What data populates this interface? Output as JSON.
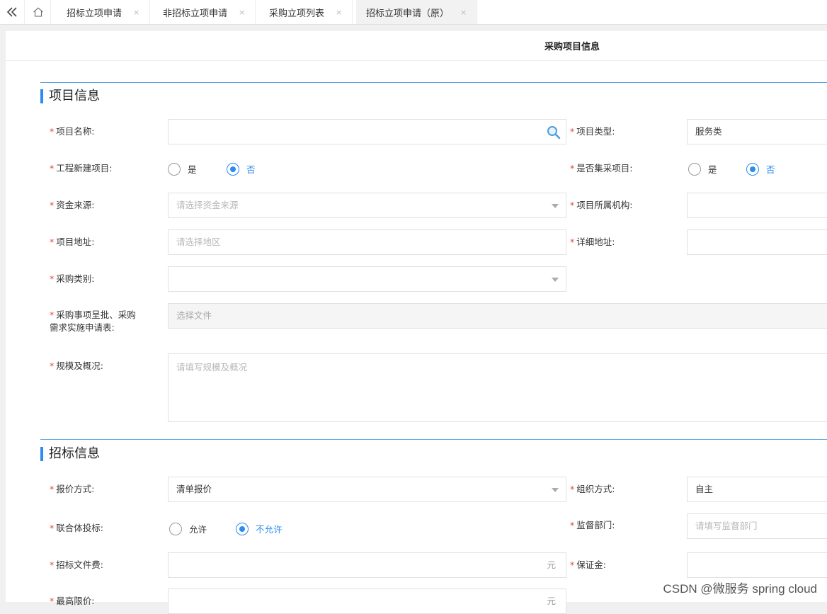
{
  "tabs": [
    {
      "label": "招标立项申请",
      "close": "×"
    },
    {
      "label": "非招标立项申请",
      "close": "×"
    },
    {
      "label": "采购立项列表",
      "close": "×"
    },
    {
      "label": "招标立项申请（原）",
      "close": "×"
    }
  ],
  "page_title": "采购项目信息",
  "sections": {
    "project": "项目信息",
    "bidding": "招标信息"
  },
  "form": {
    "project_name": {
      "label": "项目名称:",
      "value": ""
    },
    "project_type": {
      "label": "项目类型:",
      "value": "服务类"
    },
    "new_engineering": {
      "label": "工程新建项目:",
      "options": [
        "是",
        "否"
      ],
      "selected": "否"
    },
    "centralized": {
      "label": "是否集采项目:",
      "options": [
        "是",
        "否"
      ],
      "selected": "否"
    },
    "fund_source": {
      "label": "资金来源:",
      "placeholder": "请选择资金来源"
    },
    "org": {
      "label": "项目所属机构:",
      "value": ""
    },
    "address": {
      "label": "项目地址:",
      "placeholder": "请选择地区"
    },
    "detail_address": {
      "label": "详细地址:",
      "value": ""
    },
    "purchase_category": {
      "label": "采购类别:",
      "value": ""
    },
    "approval_file": {
      "label_line1": "采购事项呈批、采购",
      "label_line2": "需求实施申请表:",
      "placeholder": "选择文件"
    },
    "scale": {
      "label": "规模及概况:",
      "placeholder": "请填写规模及概况"
    },
    "quote_method": {
      "label": "报价方式:",
      "value": "清单报价"
    },
    "org_method": {
      "label": "组织方式:",
      "value": "自主"
    },
    "consortium": {
      "label": "联合体投标:",
      "options": [
        "允许",
        "不允许"
      ],
      "selected": "不允许"
    },
    "supervisor": {
      "label": "监督部门:",
      "placeholder": "请填写监督部门"
    },
    "doc_fee": {
      "label": "招标文件费:",
      "unit": "元"
    },
    "deposit": {
      "label": "保证金:",
      "value": ""
    },
    "max_price": {
      "label": "最高限价:",
      "unit": "元"
    }
  },
  "required_mark": "*",
  "watermark": "CSDN @微服务 spring cloud"
}
